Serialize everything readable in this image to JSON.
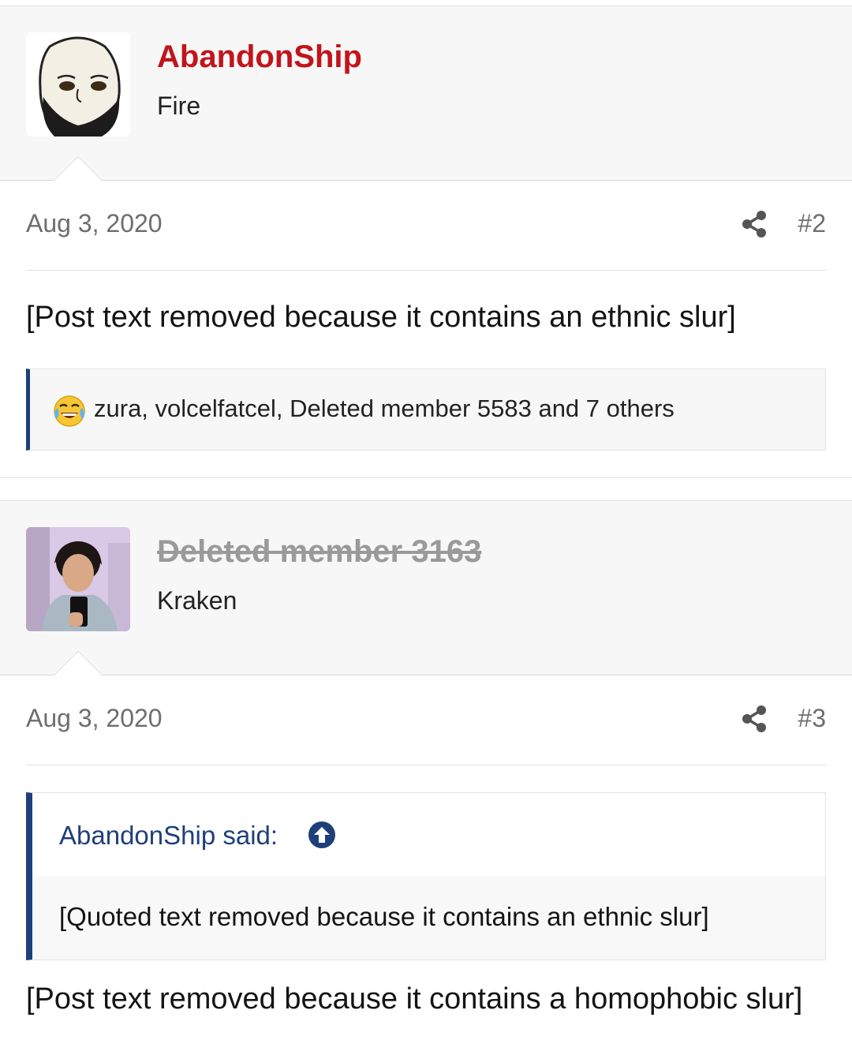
{
  "posts": [
    {
      "username": "AbandonShip",
      "user_title": "Fire",
      "avatar": "beard-wojak-avatar",
      "date": "Aug 3, 2020",
      "post_number": "#2",
      "body": "[Post text removed because it contains an ethnic slur]",
      "reactions": {
        "emoji": "crying-laughing-emoji",
        "text": "zura, volcelfatcel, Deleted member 5583 and 7 others"
      }
    },
    {
      "username": "Deleted member 3163",
      "user_title": "Kraken",
      "avatar": "selfie-photo-avatar",
      "date": "Aug 3, 2020",
      "post_number": "#3",
      "quote": {
        "author": "AbandonShip said:",
        "text": "[Quoted text removed because it contains an ethnic slur]"
      },
      "body": "[Post text removed because it contains a homophobic slur]"
    }
  ],
  "colors": {
    "username_red": "#c2141a",
    "deleted_gray": "#9a9a9a",
    "accent_blue": "#1f3f7a",
    "user_block_bg": "#f7f7f7"
  },
  "icons": [
    "share-icon",
    "arrow-up-circle-icon",
    "crying-laughing-emoji"
  ]
}
